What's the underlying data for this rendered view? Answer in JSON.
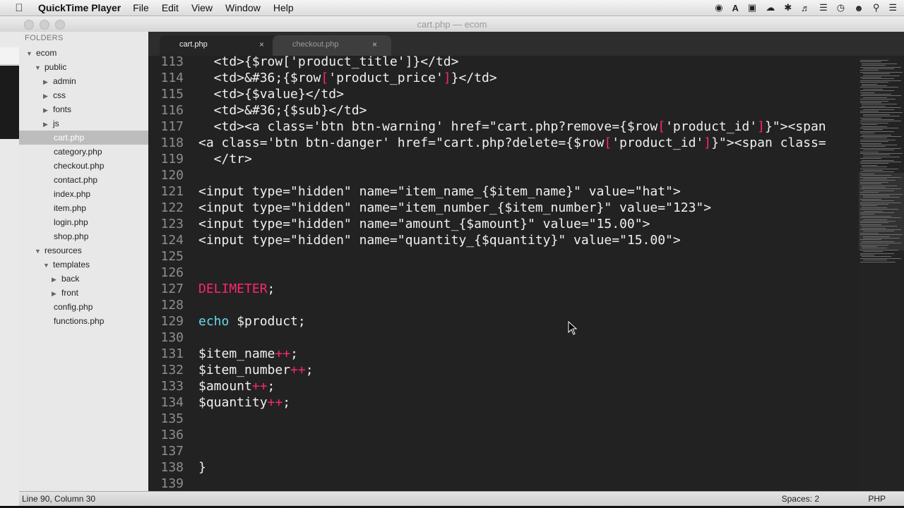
{
  "menubar": {
    "app_name": "QuickTime Player",
    "items": [
      "File",
      "Edit",
      "View",
      "Window",
      "Help"
    ],
    "status_icons": [
      "record-icon",
      "adobe-icon",
      "sync-icon",
      "bluetooth-icon",
      "volume-icon",
      "wifi-icon",
      "time-machine-icon",
      "user-icon",
      "spotlight-icon",
      "notification-center-icon"
    ]
  },
  "window": {
    "title": "cart.php — ecom"
  },
  "sidebar": {
    "header": "FOLDERS",
    "items": [
      {
        "label": "ecom",
        "type": "folder-open"
      },
      {
        "label": "public",
        "type": "folder-open"
      },
      {
        "label": "admin",
        "type": "folder"
      },
      {
        "label": "css",
        "type": "folder"
      },
      {
        "label": "fonts",
        "type": "folder"
      },
      {
        "label": "js",
        "type": "folder"
      },
      {
        "label": "cart.php",
        "type": "file",
        "selected": true
      },
      {
        "label": "category.php",
        "type": "file"
      },
      {
        "label": "checkout.php",
        "type": "file"
      },
      {
        "label": "contact.php",
        "type": "file"
      },
      {
        "label": "index.php",
        "type": "file"
      },
      {
        "label": "item.php",
        "type": "file"
      },
      {
        "label": "login.php",
        "type": "file"
      },
      {
        "label": "shop.php",
        "type": "file"
      },
      {
        "label": "resources",
        "type": "folder-open"
      },
      {
        "label": "templates",
        "type": "folder-open"
      },
      {
        "label": "back",
        "type": "folder"
      },
      {
        "label": "front",
        "type": "folder"
      },
      {
        "label": "config.php",
        "type": "file"
      },
      {
        "label": "functions.php",
        "type": "file"
      }
    ]
  },
  "tabs": [
    {
      "label": "cart.php",
      "active": true,
      "close": "×"
    },
    {
      "label": "checkout.php",
      "active": false,
      "close": "×"
    }
  ],
  "editor": {
    "lines": [
      {
        "num": "113",
        "segs": [
          {
            "t": "  <td>{$row['product_title']}</td>"
          }
        ]
      },
      {
        "num": "114",
        "segs": [
          {
            "t": "  <td>&#36;{$row"
          },
          {
            "t": "[",
            "c": "hi"
          },
          {
            "t": "'product_price'"
          },
          {
            "t": "]",
            "c": "hi"
          },
          {
            "t": "}</td>"
          }
        ]
      },
      {
        "num": "115",
        "segs": [
          {
            "t": "  <td>{$value}</td>"
          }
        ]
      },
      {
        "num": "116",
        "segs": [
          {
            "t": "  <td>&#36;{$sub}</td>"
          }
        ]
      },
      {
        "num": "117",
        "segs": [
          {
            "t": "  <td><a class='btn btn-warning' href=\"cart.php?remove={$row"
          },
          {
            "t": "[",
            "c": "hi"
          },
          {
            "t": "'product_id'"
          },
          {
            "t": "]",
            "c": "hi"
          },
          {
            "t": "}\"><span"
          }
        ]
      },
      {
        "num": "118",
        "segs": [
          {
            "t": "<a class='btn btn-danger' href=\"cart.php?delete={$row"
          },
          {
            "t": "[",
            "c": "hi"
          },
          {
            "t": "'product_id'"
          },
          {
            "t": "]",
            "c": "hi"
          },
          {
            "t": "}\"><span class="
          }
        ]
      },
      {
        "num": "119",
        "segs": [
          {
            "t": "  </tr>"
          }
        ]
      },
      {
        "num": "120",
        "segs": []
      },
      {
        "num": "121",
        "segs": [
          {
            "t": "<input type=\"hidden\" name=\"item_name_{$item_name}\" value=\"hat\">"
          }
        ]
      },
      {
        "num": "122",
        "segs": [
          {
            "t": "<input type=\"hidden\" name=\"item_number_{$item_number}\" value=\"123\">"
          }
        ]
      },
      {
        "num": "123",
        "segs": [
          {
            "t": "<input type=\"hidden\" name=\"amount_{$amount}\" value=\"15.00\">"
          }
        ]
      },
      {
        "num": "124",
        "segs": [
          {
            "t": "<input type=\"hidden\" name=\"quantity_{$quantity}\" value=\"15.00\">"
          }
        ]
      },
      {
        "num": "125",
        "segs": []
      },
      {
        "num": "126",
        "segs": []
      },
      {
        "num": "127",
        "segs": [
          {
            "t": "DELIMETER",
            "c": "kw"
          },
          {
            "t": ";"
          }
        ]
      },
      {
        "num": "128",
        "segs": []
      },
      {
        "num": "129",
        "segs": [
          {
            "t": "echo",
            "c": "bi"
          },
          {
            "t": " $product;"
          }
        ]
      },
      {
        "num": "130",
        "segs": []
      },
      {
        "num": "131",
        "segs": [
          {
            "t": "$item_name"
          },
          {
            "t": "++",
            "c": "kw"
          },
          {
            "t": ";"
          }
        ]
      },
      {
        "num": "132",
        "segs": [
          {
            "t": "$item_number"
          },
          {
            "t": "++",
            "c": "kw"
          },
          {
            "t": ";"
          }
        ]
      },
      {
        "num": "133",
        "segs": [
          {
            "t": "$amount"
          },
          {
            "t": "++",
            "c": "kw"
          },
          {
            "t": ";"
          }
        ]
      },
      {
        "num": "134",
        "segs": [
          {
            "t": "$quantity"
          },
          {
            "t": "++",
            "c": "kw"
          },
          {
            "t": ";"
          }
        ]
      },
      {
        "num": "135",
        "segs": []
      },
      {
        "num": "136",
        "segs": []
      },
      {
        "num": "137",
        "segs": []
      },
      {
        "num": "138",
        "segs": [
          {
            "t": "}"
          }
        ]
      },
      {
        "num": "139",
        "segs": []
      }
    ]
  },
  "statusbar": {
    "position": "Line 90, Column 30",
    "spaces": "Spaces: 2",
    "syntax": "PHP"
  },
  "colors": {
    "editor_bg": "#222222",
    "keyword": "#f92672",
    "builtin": "#66d9ef",
    "text": "#f0f0f0",
    "line_number": "#8e8e8e"
  }
}
